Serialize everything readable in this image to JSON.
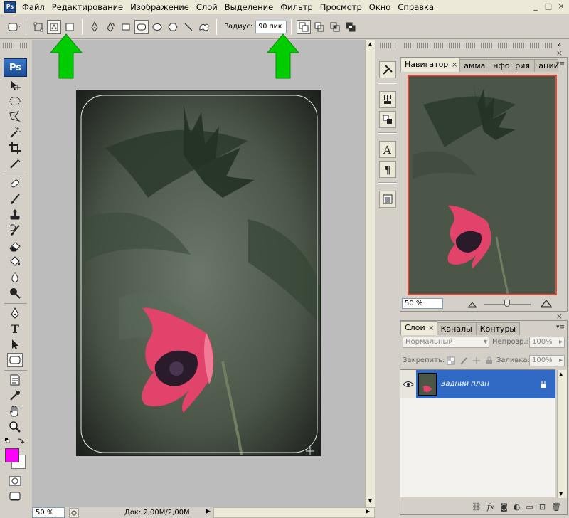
{
  "app_icon": "Ps",
  "menu": [
    "Файл",
    "Редактирование",
    "Изображение",
    "Слой",
    "Выделение",
    "Фильтр",
    "Просмотр",
    "Окно",
    "Справка"
  ],
  "window_buttons": [
    "_",
    "□",
    "×"
  ],
  "options": {
    "radius_label": "Радиус:",
    "radius_value": "90 пик"
  },
  "toolbox": {
    "logo": "Ps",
    "tools": [
      "move-tool",
      "marquee-tool",
      "lasso-tool",
      "magic-wand-tool",
      "crop-tool",
      "slice-tool",
      "healing-brush-tool",
      "brush-tool",
      "clone-stamp-tool",
      "history-brush-tool",
      "eraser-tool",
      "paint-bucket-tool",
      "blur-tool",
      "dodge-tool",
      "pen-tool",
      "type-tool",
      "path-selection-tool",
      "rounded-rectangle-tool",
      "notes-tool",
      "eyedropper-tool",
      "hand-tool",
      "zoom-tool"
    ],
    "foreground_color": "#ff00ff",
    "background_color": "#ffffff"
  },
  "status": {
    "zoom": "50 %",
    "doc": "Док: 2,00M/2,00M"
  },
  "navigator": {
    "tabs": [
      "Навигатор",
      "амма",
      "нфо",
      "рия",
      "ации"
    ],
    "zoom": "50 %",
    "frame_color": "#e34834"
  },
  "layers": {
    "tabs": [
      "Слои",
      "Каналы",
      "Контуры"
    ],
    "blend_mode": "Нормальный",
    "opacity_label": "Непрозр.:",
    "opacity_value": "100%",
    "lock_label": "Закрепить:",
    "fill_label": "Заливка:",
    "fill_value": "100%",
    "layer_name": "Задний план",
    "selection_color": "#316ac5"
  },
  "arrow_color": "#00cc00"
}
